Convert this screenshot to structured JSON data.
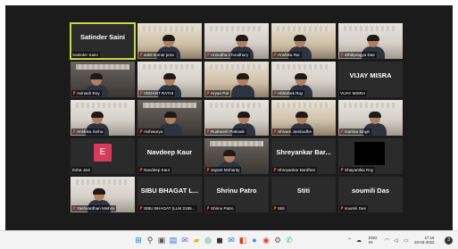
{
  "meeting": {
    "tiles": [
      {
        "display_name": "Satinder Saini",
        "label": "Satinder Saini",
        "muted": false,
        "has_video": false
      },
      {
        "display_name": "",
        "label": "ankit kumar jena",
        "muted": true,
        "has_video": true
      },
      {
        "display_name": "",
        "label": "Anirudha Choudhury",
        "muted": true,
        "has_video": true
      },
      {
        "display_name": "",
        "label": "Anshika Rai",
        "muted": true,
        "has_video": true
      },
      {
        "display_name": "",
        "label": "Sthitipragya Das",
        "muted": true,
        "has_video": true
      },
      {
        "display_name": "",
        "label": "Avinash Roy",
        "muted": true,
        "has_video": true
      },
      {
        "display_name": "",
        "label": "VEDANT RATHI",
        "muted": true,
        "has_video": true
      },
      {
        "display_name": "",
        "label": "Aryan Pal",
        "muted": true,
        "has_video": true
      },
      {
        "display_name": "",
        "label": "Abhishek Roy",
        "muted": true,
        "has_video": true
      },
      {
        "display_name": "VIJAY MISRA",
        "label": "VIJAY MISRA",
        "muted": false,
        "has_video": false
      },
      {
        "display_name": "",
        "label": "Anshika Sinha",
        "muted": true,
        "has_video": true
      },
      {
        "display_name": "",
        "label": "Aishwarya",
        "muted": true,
        "has_video": true
      },
      {
        "display_name": "",
        "label": "Rudransh Pattnaik",
        "muted": true,
        "has_video": true
      },
      {
        "display_name": "",
        "label": "Shivam Jambudhe",
        "muted": true,
        "has_video": true
      },
      {
        "display_name": "",
        "label": "Garima Singh",
        "muted": true,
        "has_video": true
      },
      {
        "display_name": "",
        "label": "Esha Jain",
        "muted": false,
        "has_video": false,
        "avatar": "E"
      },
      {
        "display_name": "Navdeep Kaur",
        "label": "Navdeep Kaur",
        "muted": true,
        "has_video": false
      },
      {
        "display_name": "",
        "label": "Jayant Mohanty",
        "muted": true,
        "has_video": true
      },
      {
        "display_name": "Shreyankar Bar...",
        "label": "Shreyankar Bardhan",
        "muted": true,
        "has_video": false
      },
      {
        "display_name": "",
        "label": "Shayantika Roy",
        "muted": true,
        "has_video": false,
        "black": true
      },
      {
        "display_name": "",
        "label": "Yashvardhan Mishra",
        "muted": true,
        "has_video": true
      },
      {
        "display_name": "SIBU BHAGAT L...",
        "label": "SIBU BHAGAT (LLM 2185...",
        "muted": true,
        "has_video": false
      },
      {
        "display_name": "Shrinu Patro",
        "label": "Shrinu Patro",
        "muted": true,
        "has_video": false
      },
      {
        "display_name": "Stiti",
        "label": "Stiti",
        "muted": true,
        "has_video": false
      },
      {
        "display_name": "soumili Das",
        "label": "soumili Das",
        "muted": true,
        "has_video": false
      }
    ]
  },
  "taskbar": {
    "language": "ENG",
    "region": "IN",
    "time": "17:16",
    "date": "20-03-2022",
    "notification_count": "3",
    "icons": [
      "windows-icon",
      "search-icon",
      "task-view-icon",
      "widgets-icon",
      "chat-icon",
      "file-explorer-icon",
      "edge-icon",
      "store-icon",
      "mail-icon",
      "office-icon",
      "zoom-icon",
      "chrome-icon",
      "settings-icon",
      "whatsapp-icon"
    ]
  }
}
